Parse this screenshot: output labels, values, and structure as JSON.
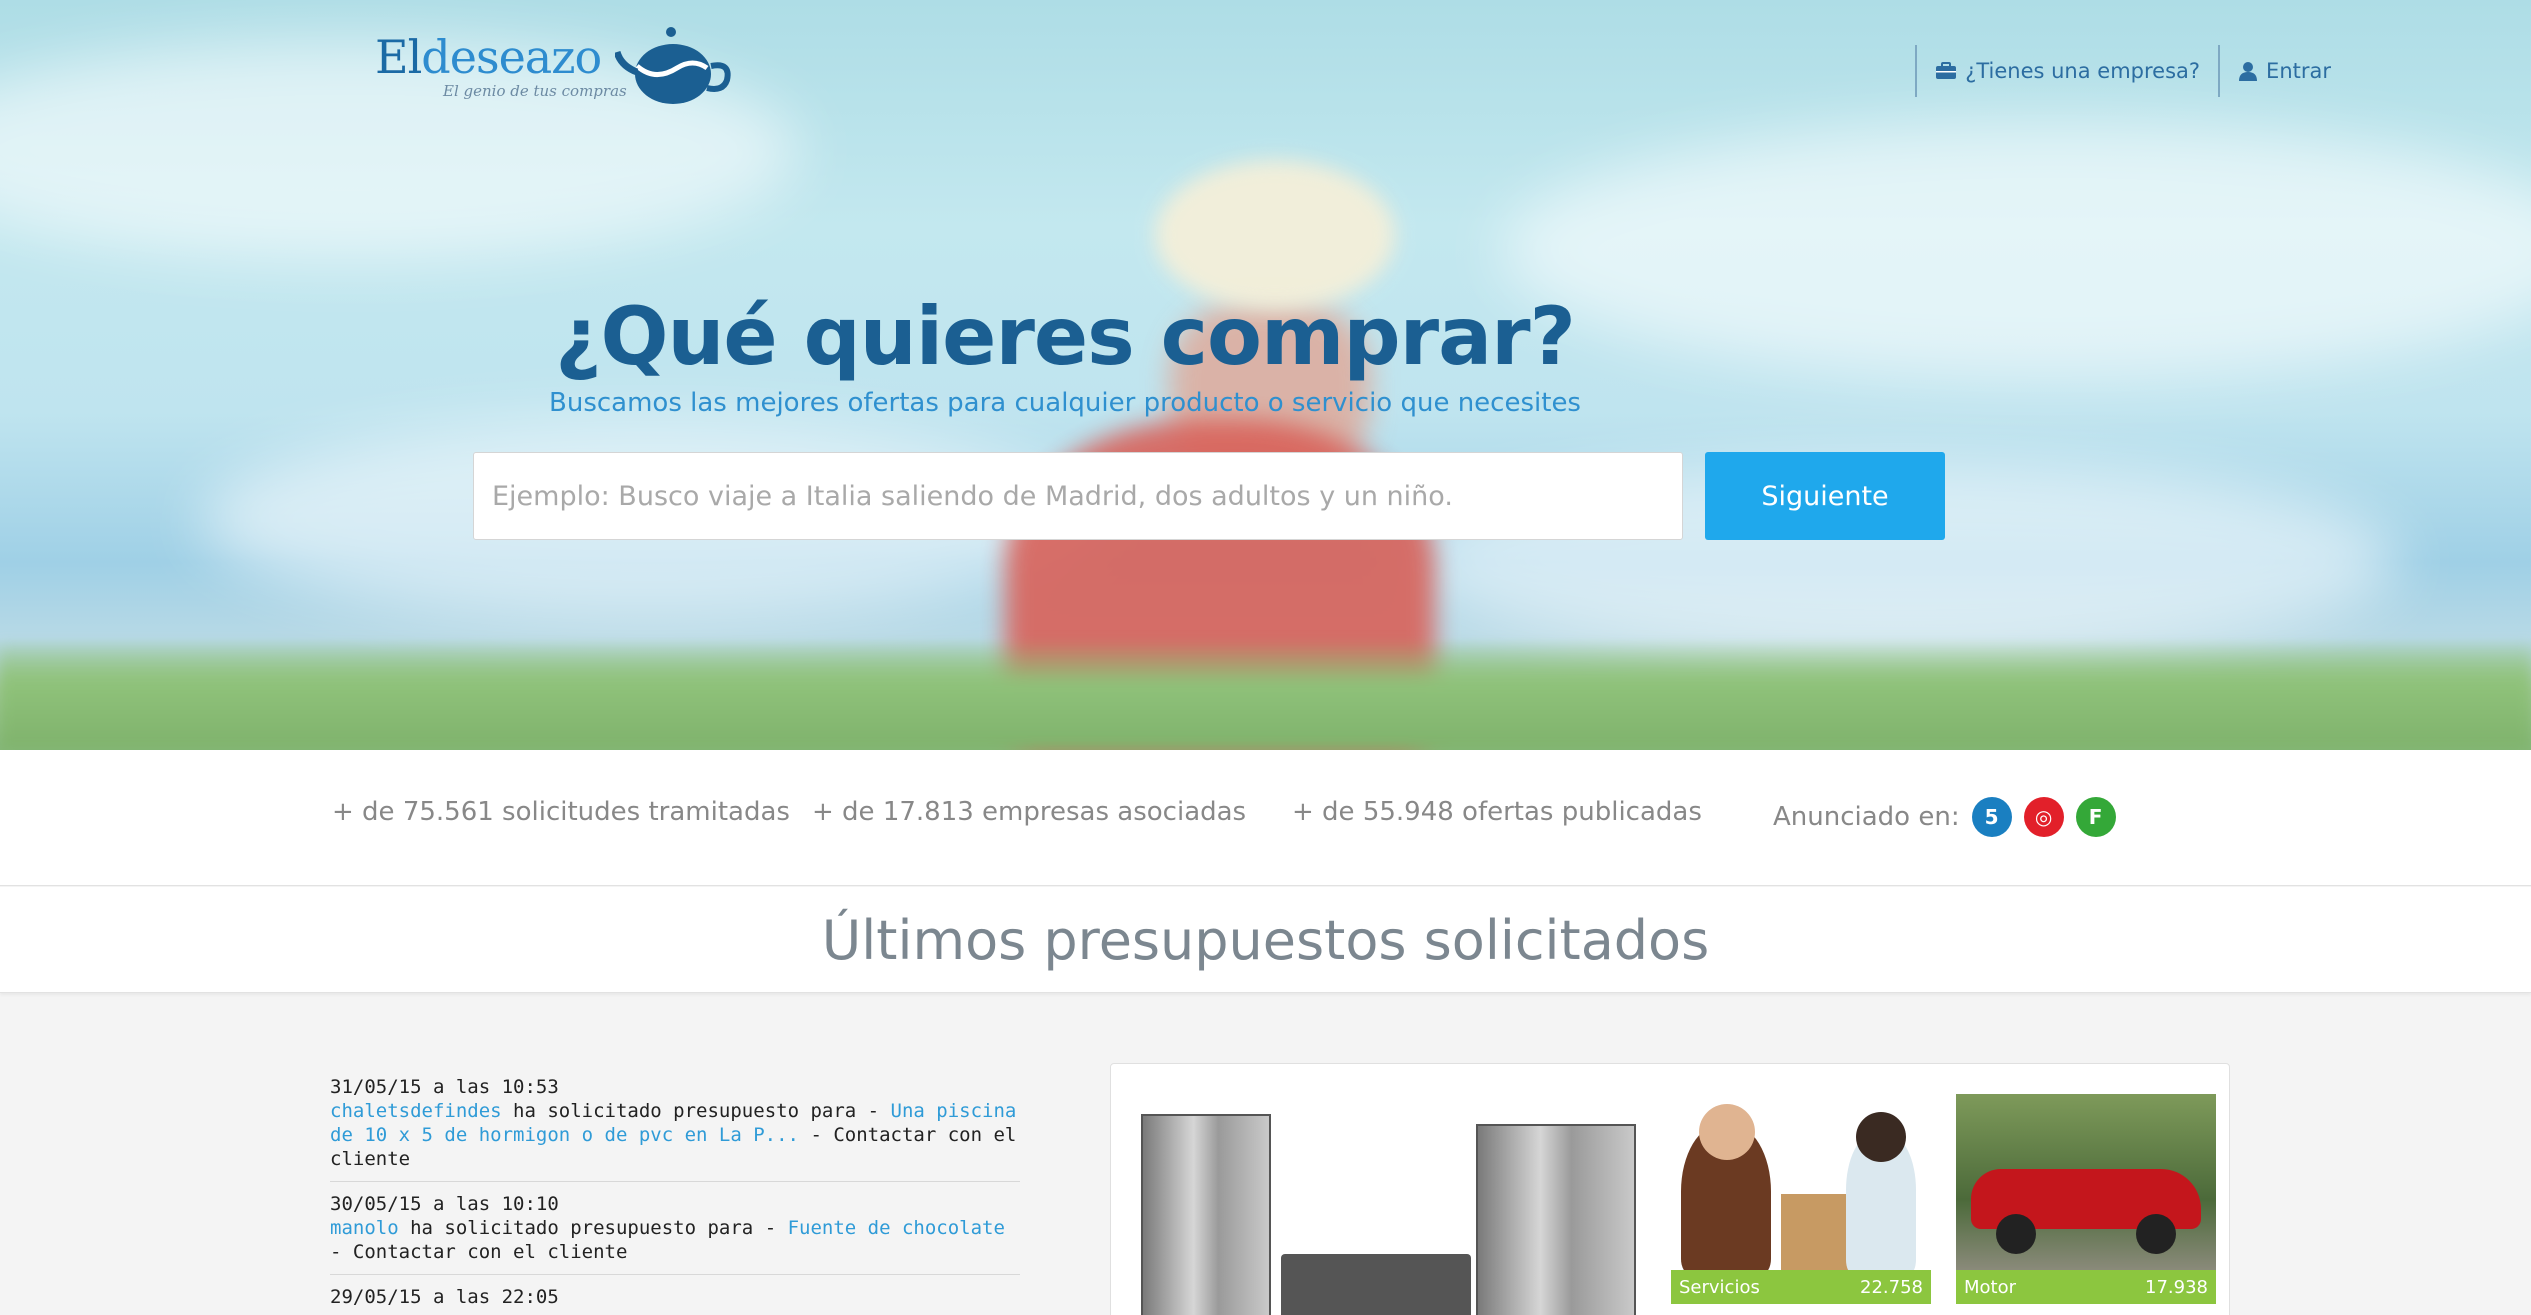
{
  "brand": {
    "name_dark": "El",
    "name_light": "deseazo",
    "tagline": "El genio de tus compras"
  },
  "nav": {
    "business_label": "¿Tienes una empresa?",
    "login_label": "Entrar",
    "business_icon": "briefcase-icon",
    "login_icon": "user-icon"
  },
  "hero": {
    "title": "¿Qué quieres comprar?",
    "subtitle": "Buscamos las mejores ofertas para cualquier producto o servicio que necesites",
    "search_placeholder": "Ejemplo: Busco viaje a Italia saliendo de Madrid, dos adultos y un niño.",
    "search_value": "",
    "button_label": "Siguiente"
  },
  "stats": {
    "requests": "+ de 75.561 solicitudes tramitadas",
    "companies": "+ de 17.813 empresas asociadas",
    "offers": "+ de 55.948 ofertas publicadas",
    "announced_label": "Anunciado en:",
    "channels": [
      {
        "label": "5",
        "color": "#1a7fc1"
      },
      {
        "label": "◎",
        "color": "#e2202a"
      },
      {
        "label": "F",
        "color": "#34a838"
      }
    ]
  },
  "section": {
    "title": "Últimos presupuestos solicitados"
  },
  "requests": [
    {
      "date": "31/05/15 a las 10:53",
      "user": "chaletsdefindes",
      "verb": " ha solicitado presupuesto para - ",
      "item": "Una piscina de 10 x 5 de hormigon o de pvc en La P...",
      "contact": " - Contactar con el cliente"
    },
    {
      "date": "30/05/15 a las 10:10",
      "user": "manolo",
      "verb": " ha solicitado presupuesto para - ",
      "item": "Fuente de chocolate",
      "contact": " - Contactar con el cliente"
    },
    {
      "date": "29/05/15 a las 22:05",
      "user": "",
      "verb": "",
      "item": "",
      "contact": ""
    }
  ],
  "categories": [
    {
      "name": "Servicios",
      "count": "22.758"
    },
    {
      "name": "Motor",
      "count": "17.938"
    }
  ],
  "colors": {
    "accent": "#1fa8ec",
    "brand": "#1b6aa5",
    "link": "#2f9bd7",
    "category_bar": "#8cc63f"
  }
}
